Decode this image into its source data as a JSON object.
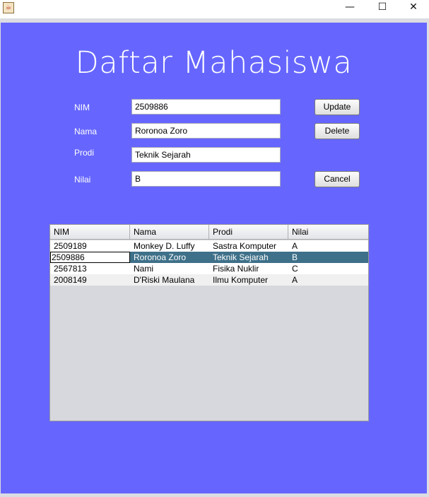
{
  "window": {
    "app_icon": "java-icon",
    "app_icon_glyph": "☕",
    "minimize_glyph": "—",
    "maximize_glyph": "☐",
    "close_glyph": "✕"
  },
  "form": {
    "title": "Daftar Mahasiswa",
    "labels": {
      "nim": "NIM",
      "nama": "Nama",
      "prodi": "Prodi",
      "nilai": "Nilai"
    },
    "values": {
      "nim": "2509886",
      "nama": "Roronoa Zoro",
      "prodi": "Teknik Sejarah",
      "nilai": "B"
    },
    "buttons": {
      "update": "Update",
      "delete": "Delete",
      "cancel": "Cancel"
    }
  },
  "table": {
    "columns": [
      "NIM",
      "Nama",
      "Prodi",
      "Nilai"
    ],
    "rows": [
      [
        "2509189",
        "Monkey D. Luffy",
        "Sastra Komputer",
        "A"
      ],
      [
        "2509886",
        "Roronoa Zoro",
        "Teknik Sejarah",
        "B"
      ],
      [
        "2567813",
        "Nami",
        "Fisika Nuklir",
        "C"
      ],
      [
        "2008149",
        "D'Riski Maulana",
        "Ilmu Komputer",
        "A"
      ]
    ],
    "selected_row": 1
  },
  "colors": {
    "background": "#6666ff",
    "selection": "#3e7089"
  }
}
